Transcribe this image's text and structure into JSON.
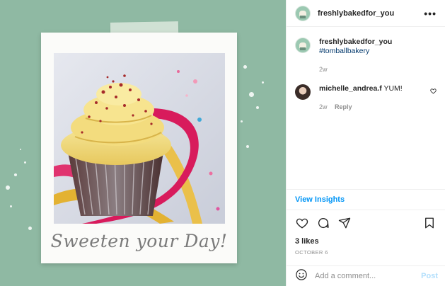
{
  "post": {
    "caption_art_text": "Sweeten your Day!"
  },
  "header": {
    "username": "freshlybakedfor_you",
    "more_icon": "more-options-icon"
  },
  "comments": [
    {
      "username": "freshlybakedfor_you",
      "text": "#tomballbakery",
      "age": "2w"
    },
    {
      "username": "michelle_andrea.f",
      "text": "YUM!",
      "age": "2w",
      "reply_label": "Reply"
    }
  ],
  "insights": {
    "label": "View Insights"
  },
  "actions": {
    "icons": [
      "like-icon",
      "comment-icon",
      "share-icon",
      "save-icon"
    ]
  },
  "likes": "3 likes",
  "date": "OCTOBER 6",
  "add_comment": {
    "placeholder": "Add a comment...",
    "post_label": "Post",
    "emoji_icon": "emoji-icon"
  },
  "colors": {
    "background_green": "#8fb9a3",
    "link_blue": "#0095f6",
    "hashtag_blue": "#00376b",
    "post_disabled": "#b2dffc"
  }
}
